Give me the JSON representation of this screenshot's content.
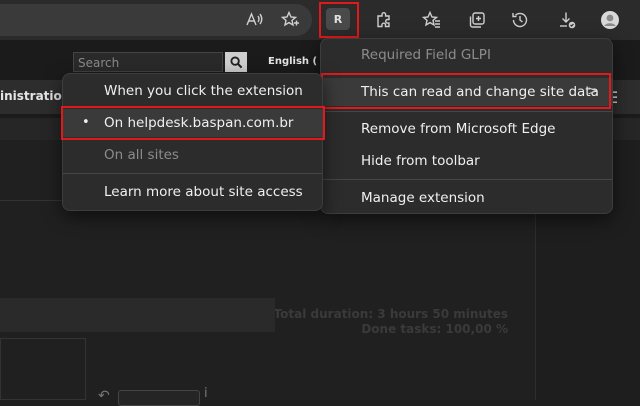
{
  "toolbar": {
    "extension_badge": "R",
    "icons": [
      "read-aloud-icon",
      "add-favorite-icon",
      "extensions-icon",
      "favorites-icon",
      "collections-icon",
      "history-icon",
      "downloads-icon",
      "profile-icon"
    ]
  },
  "page": {
    "search_placeholder": "Search",
    "language": "English (",
    "nav_admin": "inistratio",
    "total_duration": "Total duration: 3 hours 50 minutes",
    "done_tasks": "Done tasks: 100,00 %"
  },
  "extension_menu": {
    "title": "Required Field GLPI",
    "site_data": "This can read and change site data",
    "remove": "Remove from Microsoft Edge",
    "hide": "Hide from toolbar",
    "manage": "Manage extension"
  },
  "site_access_menu": {
    "on_click": "When you click the extension",
    "on_site": "On helpdesk.baspan.com.br",
    "all_sites": "On all sites",
    "learn_more": "Learn more about site access"
  }
}
